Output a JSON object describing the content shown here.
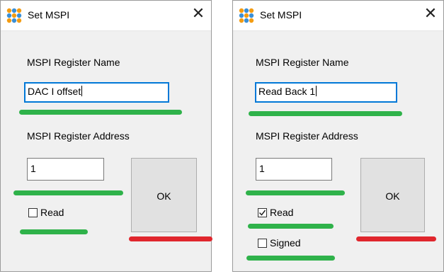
{
  "dialogs": [
    {
      "title": "Set MSPI",
      "name_label": "MSPI Register Name",
      "name_value": "DAC I offset",
      "address_label": "MSPI Register Address",
      "address_value": "1",
      "ok_label": "OK",
      "read_label": "Read",
      "read_checked": false
    },
    {
      "title": "Set MSPI",
      "name_label": "MSPI Register Name",
      "name_value": "Read Back 1",
      "address_label": "MSPI Register Address",
      "address_value": "1",
      "ok_label": "OK",
      "read_label": "Read",
      "read_checked": true,
      "signed_label": "Signed",
      "signed_checked": false
    }
  ],
  "icons": {
    "app": "app-logo-icon",
    "close": "close-icon",
    "check": "checkmark-icon"
  },
  "colors": {
    "highlight_green": "#2fb24a",
    "highlight_red": "#e0262d",
    "focus_border": "#0078d7"
  }
}
